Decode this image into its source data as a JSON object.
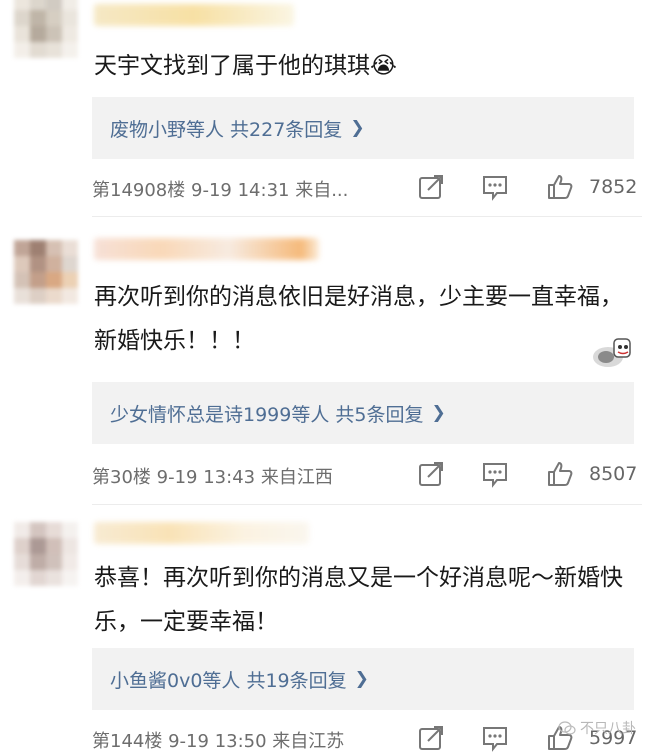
{
  "comments": [
    {
      "text": "天宇文找到了属于他的琪琪😭",
      "reply_summary": "废物小野等人 共227条回复",
      "floor": "第14908楼",
      "date": "9-19",
      "time": "14:31",
      "location": "来自...",
      "likes": "7852"
    },
    {
      "text": "再次听到你的消息依旧是好消息，少主要一直幸福，新婚快乐！！！",
      "reply_summary": "少女情怀总是诗1999等人 共5条回复",
      "floor": "第30楼",
      "date": "9-19",
      "time": "13:43",
      "location": "来自江西",
      "likes": "8507"
    },
    {
      "text": "恭喜！再次听到你的消息又是一个好消息呢～新婚快乐，一定要幸福！",
      "reply_summary": "小鱼酱0v0等人 共19条回复",
      "floor": "第144楼",
      "date": "9-19",
      "time": "13:50",
      "location": "来自江苏",
      "likes": "5997"
    }
  ],
  "watermark": "不只八卦",
  "colors": {
    "link": "#4f6e94",
    "meta": "#6d6d6d",
    "reply_bg": "#f2f2f2"
  }
}
